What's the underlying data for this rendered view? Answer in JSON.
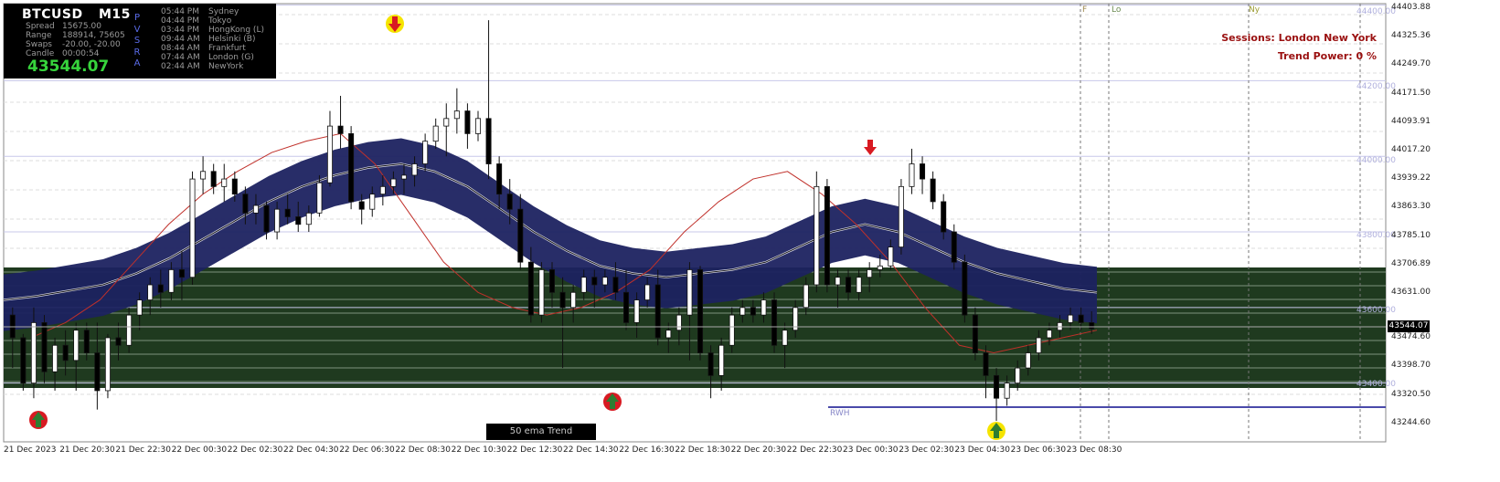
{
  "symbol": {
    "name": "BTCUSD",
    "timeframe": "M15"
  },
  "info_panel": {
    "specs": [
      {
        "key": "Spread",
        "value": "15675.00"
      },
      {
        "key": "Range",
        "value": "188914, 75605"
      },
      {
        "key": "Swaps",
        "value": "-20.00, -20.00"
      },
      {
        "key": "Candle",
        "value": "00:00:54"
      }
    ],
    "big_price": "43544.07",
    "pvsra_label": "PVSRA",
    "sessions": [
      {
        "time": "05:44 PM",
        "name": "Sydney"
      },
      {
        "time": "04:44 PM",
        "name": "Tokyo"
      },
      {
        "time": "03:44 PM",
        "name": "HongKong  (L)"
      },
      {
        "time": "09:44 AM",
        "name": "Helsinki  (B)"
      },
      {
        "time": "08:44 AM",
        "name": "Frankfurt"
      },
      {
        "time": "07:44 AM",
        "name": "London  (G)"
      },
      {
        "time": "02:44 AM",
        "name": "NewYork"
      }
    ]
  },
  "right_info": {
    "sessions_text": "Sessions:  London  New York",
    "trend_power_text": "Trend Power: 0 %"
  },
  "price_axis": [
    "44403.88",
    "44325.36",
    "44249.70",
    "44171.50",
    "44093.91",
    "44017.20",
    "43939.22",
    "43863.30",
    "43785.10",
    "43706.89",
    "43631.00",
    "43474.60",
    "43398.70",
    "43320.50",
    "43244.60"
  ],
  "current_price": "43544.07",
  "time_axis": [
    "21 Dec 2023",
    "21 Dec 20:30",
    "21 Dec 22:30",
    "22 Dec 00:30",
    "22 Dec 02:30",
    "22 Dec 04:30",
    "22 Dec 06:30",
    "22 Dec 08:30",
    "22 Dec 10:30",
    "22 Dec 12:30",
    "22 Dec 14:30",
    "22 Dec 16:30",
    "22 Dec 18:30",
    "22 Dec 20:30",
    "22 Dec 22:30",
    "23 Dec 00:30",
    "23 Dec 02:30",
    "23 Dec 04:30",
    "23 Dec 06:30",
    "23 Dec 08:30"
  ],
  "level_labels": [
    "44400.00",
    "44200.00",
    "44000.00",
    "43800.00",
    "43600.00",
    "43400.00"
  ],
  "session_markers": [
    "F",
    "Lo",
    "Ny"
  ],
  "ema_label": "50 ema Trend",
  "rwh_label": "RWH",
  "colors": {
    "band": "#1c2260",
    "band_light": "#2c3478",
    "zone": "#1f3a1f",
    "ema_red": "#c0302a",
    "bull": "#ffffff",
    "bear": "#000000",
    "price_green": "#37d43c",
    "session_text": "#9a1010",
    "arrow_red": "#d81a22",
    "arrow_yellow": "#f5e400",
    "arrow_green": "#2e7d32"
  },
  "chart_data": {
    "type": "candlestick",
    "ylim": [
      43244.6,
      44403.88
    ],
    "candles": [
      [
        43580,
        43600,
        43440,
        43520
      ],
      [
        43520,
        43530,
        43380,
        43400
      ],
      [
        43400,
        43600,
        43360,
        43560
      ],
      [
        43560,
        43580,
        43400,
        43430
      ],
      [
        43430,
        43520,
        43380,
        43500
      ],
      [
        43500,
        43540,
        43420,
        43460
      ],
      [
        43460,
        43560,
        43380,
        43540
      ],
      [
        43540,
        43560,
        43460,
        43480
      ],
      [
        43480,
        43560,
        43330,
        43380
      ],
      [
        43380,
        43530,
        43360,
        43520
      ],
      [
        43520,
        43560,
        43460,
        43500
      ],
      [
        43500,
        43600,
        43480,
        43580
      ],
      [
        43580,
        43640,
        43540,
        43620
      ],
      [
        43620,
        43680,
        43580,
        43660
      ],
      [
        43660,
        43700,
        43600,
        43640
      ],
      [
        43640,
        43720,
        43620,
        43700
      ],
      [
        43700,
        43750,
        43620,
        43680
      ],
      [
        43680,
        43960,
        43660,
        43940
      ],
      [
        43940,
        44000,
        43900,
        43960
      ],
      [
        43960,
        43980,
        43900,
        43920
      ],
      [
        43920,
        43980,
        43880,
        43940
      ],
      [
        43940,
        43960,
        43880,
        43900
      ],
      [
        43900,
        43920,
        43820,
        43850
      ],
      [
        43850,
        43900,
        43820,
        43870
      ],
      [
        43870,
        43880,
        43780,
        43800
      ],
      [
        43800,
        43880,
        43780,
        43860
      ],
      [
        43860,
        43900,
        43820,
        43840
      ],
      [
        43840,
        43880,
        43800,
        43820
      ],
      [
        43820,
        43870,
        43800,
        43850
      ],
      [
        43850,
        43950,
        43840,
        43930
      ],
      [
        43930,
        44120,
        43920,
        44080
      ],
      [
        44080,
        44160,
        44020,
        44060
      ],
      [
        44060,
        44080,
        43860,
        43880
      ],
      [
        43880,
        43900,
        43820,
        43860
      ],
      [
        43860,
        43920,
        43840,
        43900
      ],
      [
        43900,
        43950,
        43870,
        43920
      ],
      [
        43920,
        43960,
        43900,
        43940
      ],
      [
        43940,
        43980,
        43900,
        43950
      ],
      [
        43950,
        44000,
        43920,
        43980
      ],
      [
        43980,
        44060,
        43960,
        44040
      ],
      [
        44040,
        44100,
        44020,
        44080
      ],
      [
        44080,
        44140,
        44000,
        44100
      ],
      [
        44100,
        44180,
        44060,
        44120
      ],
      [
        44120,
        44140,
        44020,
        44060
      ],
      [
        44060,
        44120,
        44040,
        44100
      ],
      [
        44100,
        44360,
        43940,
        43980
      ],
      [
        43980,
        44000,
        43860,
        43900
      ],
      [
        43900,
        43940,
        43820,
        43860
      ],
      [
        43860,
        43900,
        43700,
        43720
      ],
      [
        43720,
        43760,
        43560,
        43580
      ],
      [
        43580,
        43720,
        43560,
        43700
      ],
      [
        43700,
        43720,
        43600,
        43640
      ],
      [
        43640,
        43680,
        43440,
        43600
      ],
      [
        43600,
        43660,
        43560,
        43640
      ],
      [
        43640,
        43700,
        43620,
        43680
      ],
      [
        43680,
        43700,
        43600,
        43660
      ],
      [
        43660,
        43700,
        43640,
        43680
      ],
      [
        43680,
        43720,
        43620,
        43640
      ],
      [
        43640,
        43700,
        43540,
        43560
      ],
      [
        43560,
        43640,
        43520,
        43620
      ],
      [
        43620,
        43680,
        43600,
        43660
      ],
      [
        43660,
        43700,
        43500,
        43520
      ],
      [
        43520,
        43560,
        43480,
        43540
      ],
      [
        43540,
        43600,
        43500,
        43580
      ],
      [
        43580,
        43720,
        43460,
        43700
      ],
      [
        43700,
        43710,
        43460,
        43480
      ],
      [
        43480,
        43500,
        43360,
        43420
      ],
      [
        43420,
        43520,
        43380,
        43500
      ],
      [
        43500,
        43600,
        43480,
        43580
      ],
      [
        43580,
        43620,
        43560,
        43600
      ],
      [
        43600,
        43620,
        43560,
        43580
      ],
      [
        43580,
        43640,
        43560,
        43620
      ],
      [
        43620,
        43640,
        43480,
        43500
      ],
      [
        43500,
        43560,
        43440,
        43540
      ],
      [
        43540,
        43620,
        43520,
        43600
      ],
      [
        43600,
        43680,
        43580,
        43660
      ],
      [
        43660,
        43960,
        43640,
        43920
      ],
      [
        43920,
        43940,
        43640,
        43660
      ],
      [
        43660,
        43700,
        43600,
        43680
      ],
      [
        43680,
        43700,
        43620,
        43640
      ],
      [
        43640,
        43700,
        43620,
        43680
      ],
      [
        43680,
        43720,
        43640,
        43700
      ],
      [
        43700,
        43740,
        43680,
        43710
      ],
      [
        43710,
        43780,
        43700,
        43760
      ],
      [
        43760,
        43940,
        43740,
        43920
      ],
      [
        43920,
        44020,
        43900,
        43980
      ],
      [
        43980,
        44000,
        43900,
        43940
      ],
      [
        43940,
        43960,
        43860,
        43880
      ],
      [
        43880,
        43900,
        43780,
        43800
      ],
      [
        43800,
        43820,
        43700,
        43720
      ],
      [
        43720,
        43740,
        43560,
        43580
      ],
      [
        43580,
        43600,
        43460,
        43480
      ],
      [
        43480,
        43500,
        43360,
        43420
      ],
      [
        43420,
        43440,
        43300,
        43360
      ],
      [
        43360,
        43420,
        43340,
        43400
      ],
      [
        43400,
        43460,
        43380,
        43440
      ],
      [
        43440,
        43500,
        43420,
        43480
      ],
      [
        43480,
        43540,
        43460,
        43520
      ],
      [
        43520,
        43560,
        43500,
        43540
      ],
      [
        43540,
        43580,
        43520,
        43560
      ],
      [
        43560,
        43600,
        43540,
        43580
      ],
      [
        43580,
        43600,
        43540,
        43560
      ],
      [
        43560,
        43590,
        43530,
        43544.07
      ]
    ],
    "ema_50": [
      43620,
      43630,
      43645,
      43660,
      43690,
      43730,
      43780,
      43830,
      43880,
      43920,
      43950,
      43970,
      43980,
      43960,
      43920,
      43860,
      43800,
      43750,
      43710,
      43690,
      43680,
      43690,
      43700,
      43720,
      43760,
      43800,
      43820,
      43800,
      43760,
      43720,
      43690,
      43670,
      43650,
      43640
    ],
    "ema_short": [
      43520,
      43560,
      43620,
      43720,
      43820,
      43900,
      43960,
      44010,
      44040,
      44060,
      43980,
      43850,
      43720,
      43640,
      43600,
      43580,
      43600,
      43640,
      43700,
      43800,
      43880,
      43940,
      43960,
      43900,
      43820,
      43720,
      43600,
      43500,
      43480,
      43500,
      43520,
      43540
    ],
    "levels": [
      44400,
      44200,
      44000,
      43800,
      43600,
      43400
    ]
  }
}
